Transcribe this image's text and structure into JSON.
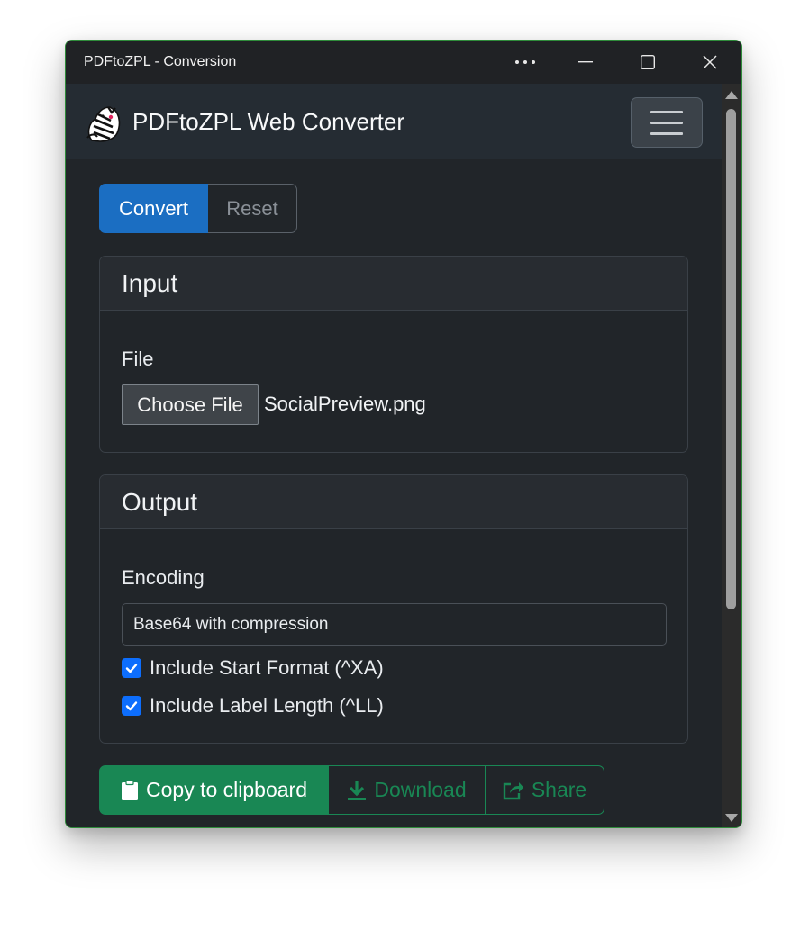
{
  "window": {
    "title": "PDFtoZPL - Conversion"
  },
  "navbar": {
    "brand": "PDFtoZPL Web Converter",
    "logo_icon": "zebra-logo-icon",
    "toggle_icon": "hamburger-menu-icon"
  },
  "tabs": {
    "convert_label": "Convert",
    "reset_label": "Reset"
  },
  "input_card": {
    "title": "Input",
    "file_label": "File",
    "choose_file_label": "Choose File",
    "file_name": "SocialPreview.png"
  },
  "output_card": {
    "title": "Output",
    "encoding_label": "Encoding",
    "encoding_value": "Base64 with compression",
    "checkboxes": [
      {
        "label": "Include Start Format (^XA)",
        "checked": true
      },
      {
        "label": "Include Label Length (^LL)",
        "checked": true
      }
    ]
  },
  "actions": {
    "copy_label": "Copy to clipboard",
    "download_label": "Download",
    "share_label": "Share"
  },
  "colors": {
    "primary": "#1b6ec2",
    "success": "#198754",
    "checkbox": "#0d6efd",
    "background": "#212529",
    "window_border": "#2e8b3a"
  }
}
